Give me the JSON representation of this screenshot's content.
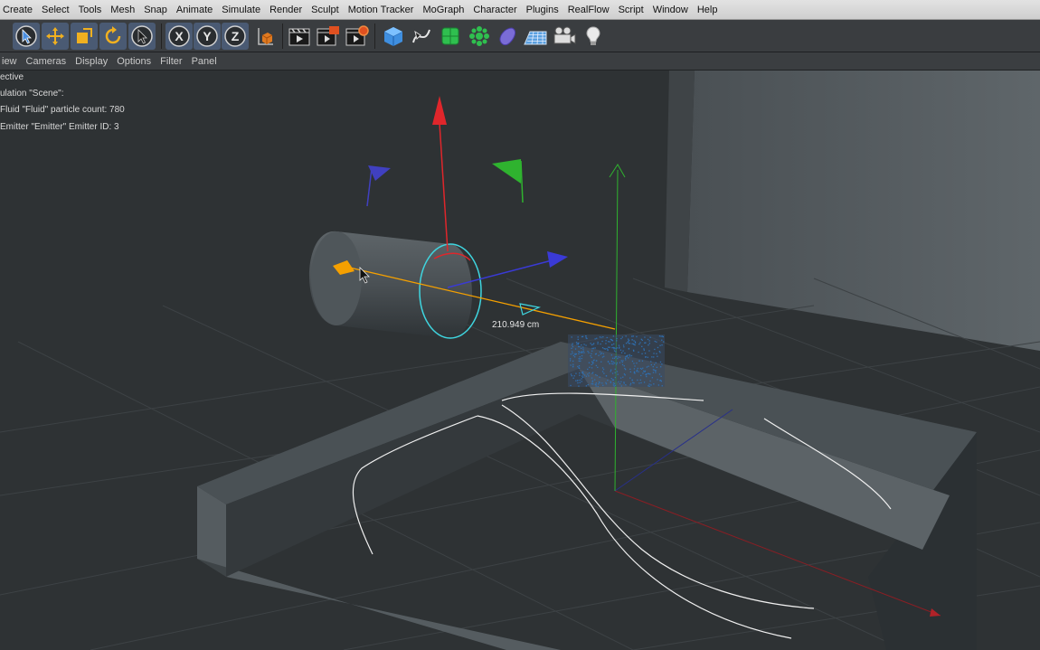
{
  "menu": [
    "Create",
    "Select",
    "Tools",
    "Mesh",
    "Snap",
    "Animate",
    "Simulate",
    "Render",
    "Sculpt",
    "Motion Tracker",
    "MoGraph",
    "Character",
    "Plugins",
    "RealFlow",
    "Script",
    "Window",
    "Help"
  ],
  "toolbar": {
    "icons": [
      "select-cursor-icon",
      "move-icon",
      "scale-icon",
      "rotate-icon",
      "live-select-icon",
      "x-axis-lock-icon",
      "y-axis-lock-icon",
      "z-axis-lock-icon",
      "world-coordinates-icon",
      "render-view-icon",
      "render-picture-viewer-icon",
      "render-settings-icon",
      "cube-icon",
      "spline-pen-icon",
      "subdivision-surface-icon",
      "cloner-icon",
      "deformer-icon",
      "floor-icon",
      "camera-icon",
      "light-icon"
    ],
    "axis_labels": {
      "x": "X",
      "y": "Y",
      "z": "Z"
    }
  },
  "viewport_menu": [
    "iew",
    "Cameras",
    "Display",
    "Options",
    "Filter",
    "Panel"
  ],
  "viewport": {
    "camera_label": "ective",
    "hud_lines": [
      "ulation \"Scene\":",
      "Fluid \"Fluid\" particle count: 780",
      "Emitter \"Emitter\" Emitter ID: 3"
    ],
    "measure_label": "210.949 cm"
  },
  "colors": {
    "menubar_bg": "#d8d8d8",
    "toolbar_bg": "#3a3d40",
    "viewport_bg": "#2e3234",
    "axis_x": "#e0262b",
    "axis_y": "#2fb32f",
    "axis_z": "#3a3ad6",
    "selection": "#f5a000",
    "emitter_ring": "#3fd6e0"
  }
}
